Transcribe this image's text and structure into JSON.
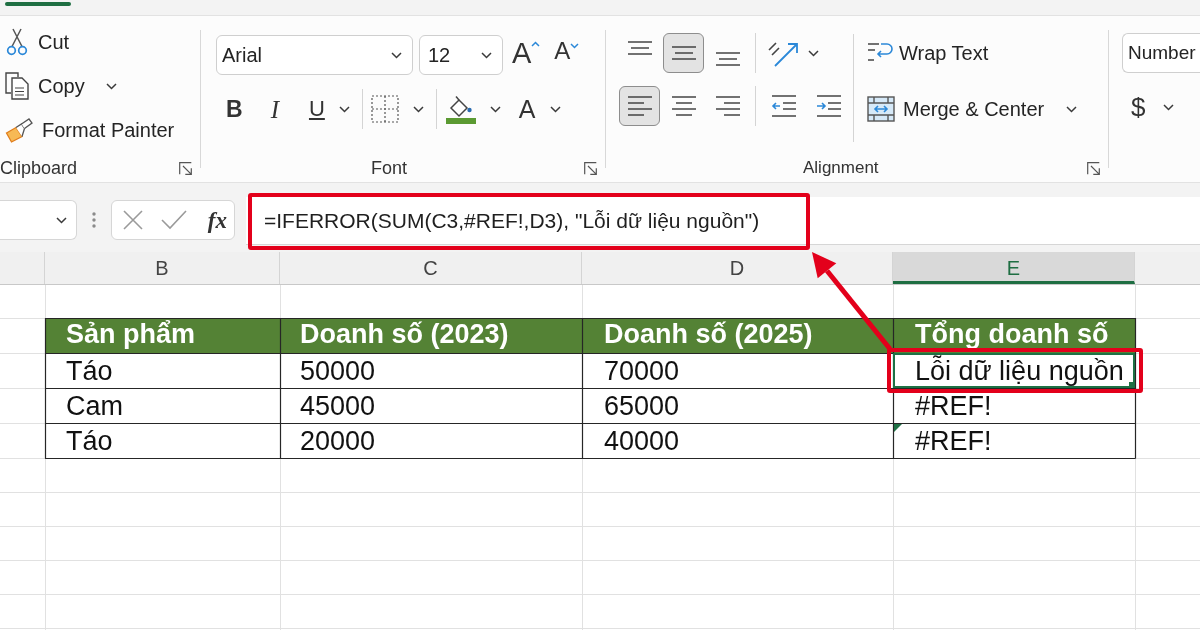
{
  "ribbon": {
    "clipboard": {
      "items": [
        {
          "kind": "cut",
          "label": "Cut",
          "dropdown": false
        },
        {
          "kind": "copy",
          "label": "Copy",
          "dropdown": true
        },
        {
          "kind": "format_painter",
          "label": "Format Painter",
          "dropdown": false
        }
      ],
      "label": "Clipboard"
    },
    "font": {
      "font_name": "Arial",
      "font_size": "12",
      "size_buttons": [
        {
          "kind": "grow",
          "text": "A"
        },
        {
          "kind": "shrink",
          "text": "A"
        }
      ],
      "format_buttons": [
        {
          "kind": "bold",
          "text": "B",
          "dropdown": false
        },
        {
          "kind": "italic",
          "text": "I",
          "dropdown": false
        },
        {
          "kind": "underline",
          "text": "U",
          "dropdown": true
        },
        {
          "kind": "borders",
          "dropdown": true
        },
        {
          "kind": "fill_color",
          "dropdown": true
        },
        {
          "kind": "font_color",
          "text": "A",
          "dropdown": true
        }
      ],
      "label": "Font"
    },
    "alignment": {
      "vertical": [
        {
          "kind": "top",
          "selected": false
        },
        {
          "kind": "middle",
          "selected": true
        },
        {
          "kind": "bottom",
          "selected": false
        }
      ],
      "horizontal": [
        {
          "kind": "left",
          "selected": true
        },
        {
          "kind": "center",
          "selected": false
        },
        {
          "kind": "right",
          "selected": false
        }
      ],
      "wrap_text": "Wrap Text",
      "merge": "Merge & Center",
      "label": "Alignment"
    },
    "number": {
      "format": "Number",
      "currency": "$"
    }
  },
  "formula_bar": {
    "function_button": "fx",
    "formula": "=IFERROR(SUM(C3,#REF!,D3), \"Lỗi dữ liệu nguồn\")"
  },
  "columns": [
    {
      "label": "B",
      "selected": false
    },
    {
      "label": "C",
      "selected": false
    },
    {
      "label": "D",
      "selected": false
    },
    {
      "label": "E",
      "selected": true
    }
  ],
  "table": {
    "header": [
      "Sản phẩm",
      "Doanh số (2023)",
      "Doanh số (2025)",
      "Tổng doanh số"
    ],
    "rows": [
      {
        "cells": [
          {
            "text": "Táo",
            "selected": false,
            "error_mark": false
          },
          {
            "text": "50000",
            "selected": false,
            "error_mark": false
          },
          {
            "text": "70000",
            "selected": false,
            "error_mark": false
          },
          {
            "text": "Lỗi dữ liệu nguồn",
            "selected": true,
            "error_mark": false
          }
        ]
      },
      {
        "cells": [
          {
            "text": "Cam",
            "selected": false,
            "error_mark": false
          },
          {
            "text": "45000",
            "selected": false,
            "error_mark": false
          },
          {
            "text": "65000",
            "selected": false,
            "error_mark": false
          },
          {
            "text": "#REF!",
            "selected": false,
            "error_mark": false
          }
        ]
      },
      {
        "cells": [
          {
            "text": "Táo",
            "selected": false,
            "error_mark": false
          },
          {
            "text": "20000",
            "selected": false,
            "error_mark": false
          },
          {
            "text": "40000",
            "selected": false,
            "error_mark": false
          },
          {
            "text": "#REF!",
            "selected": false,
            "error_mark": true
          }
        ]
      }
    ]
  }
}
